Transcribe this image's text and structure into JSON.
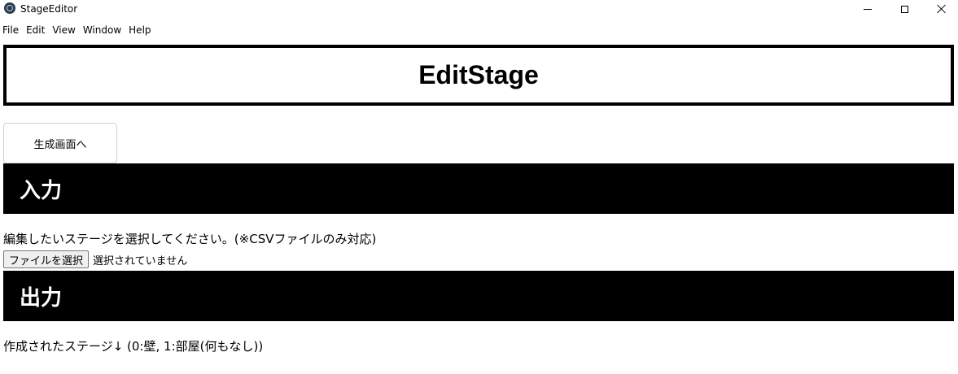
{
  "window": {
    "title": "StageEditor"
  },
  "menu": {
    "items": [
      "File",
      "Edit",
      "View",
      "Window",
      "Help"
    ]
  },
  "header": {
    "title": "EditStage"
  },
  "nav": {
    "generate_button_label": "生成画面へ"
  },
  "input_section": {
    "title": "入力",
    "instruction": "編集したいステージを選択してください。(※CSVファイルのみ対応)",
    "file_button_label": "ファイルを選択",
    "file_status": "選択されていません"
  },
  "output_section": {
    "title": "出力",
    "description": "作成されたステージ↓ (0:壁, 1:部屋(何もなし))"
  },
  "colors": {
    "section_bar_bg": "#000000",
    "section_bar_text": "#ffffff",
    "header_border": "#000000"
  },
  "icons": {
    "app": "app-icon",
    "minimize": "minimize-icon",
    "maximize": "maximize-icon",
    "close": "close-icon"
  }
}
